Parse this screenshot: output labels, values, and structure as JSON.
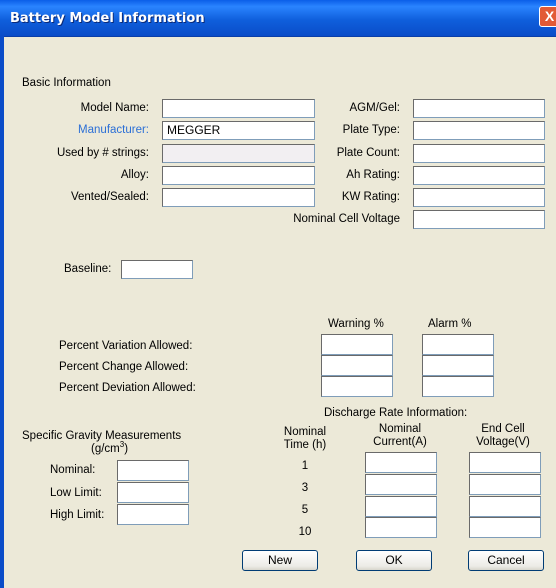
{
  "window": {
    "title": "Battery Model Information",
    "close_label": "X"
  },
  "basic": {
    "section_label": "Basic Information",
    "model_name_label": "Model Name:",
    "model_name_value": "",
    "manufacturer_label": "Manufacturer:",
    "manufacturer_value": "MEGGER",
    "used_by_label": "Used by # strings:",
    "used_by_value": "",
    "alloy_label": "Alloy:",
    "alloy_value": "",
    "vented_label": "Vented/Sealed:",
    "vented_value": "",
    "agm_label": "AGM/Gel:",
    "agm_value": "",
    "plate_type_label": "Plate Type:",
    "plate_type_value": "",
    "plate_count_label": "Plate Count:",
    "plate_count_value": "",
    "ah_label": "Ah Rating:",
    "ah_value": "",
    "kw_label": "KW Rating:",
    "kw_value": "",
    "ncv_label": "Nominal Cell Voltage",
    "ncv_value": ""
  },
  "baseline": {
    "label": "Baseline:",
    "value": ""
  },
  "percent": {
    "warning_header": "Warning %",
    "alarm_header": "Alarm %",
    "rows": [
      {
        "label": "Percent Variation Allowed:",
        "warning": "",
        "alarm": ""
      },
      {
        "label": "Percent Change Allowed:",
        "warning": "",
        "alarm": ""
      },
      {
        "label": "Percent Deviation Allowed:",
        "warning": "",
        "alarm": ""
      }
    ]
  },
  "specific_gravity": {
    "title_line1": "Specific Gravity Measurements",
    "title_line2_prefix": "(g/cm",
    "title_sup": "3",
    "title_line2_suffix": ")",
    "nominal_label": "Nominal:",
    "nominal_value": "",
    "low_label": "Low Limit:",
    "low_value": "",
    "high_label": "High Limit:",
    "high_value": ""
  },
  "discharge": {
    "title": "Discharge Rate Information:",
    "time_header_1": "Nominal",
    "time_header_2": "Time (h)",
    "current_header_1": "Nominal",
    "current_header_2": "Current(A)",
    "voltage_header_1": "End Cell",
    "voltage_header_2": "Voltage(V)",
    "rows": [
      {
        "time": "1",
        "current": "",
        "voltage": ""
      },
      {
        "time": "3",
        "current": "",
        "voltage": ""
      },
      {
        "time": "5",
        "current": "",
        "voltage": ""
      },
      {
        "time": "10",
        "current": "",
        "voltage": ""
      }
    ]
  },
  "buttons": {
    "new": "New",
    "ok": "OK",
    "cancel": "Cancel"
  }
}
